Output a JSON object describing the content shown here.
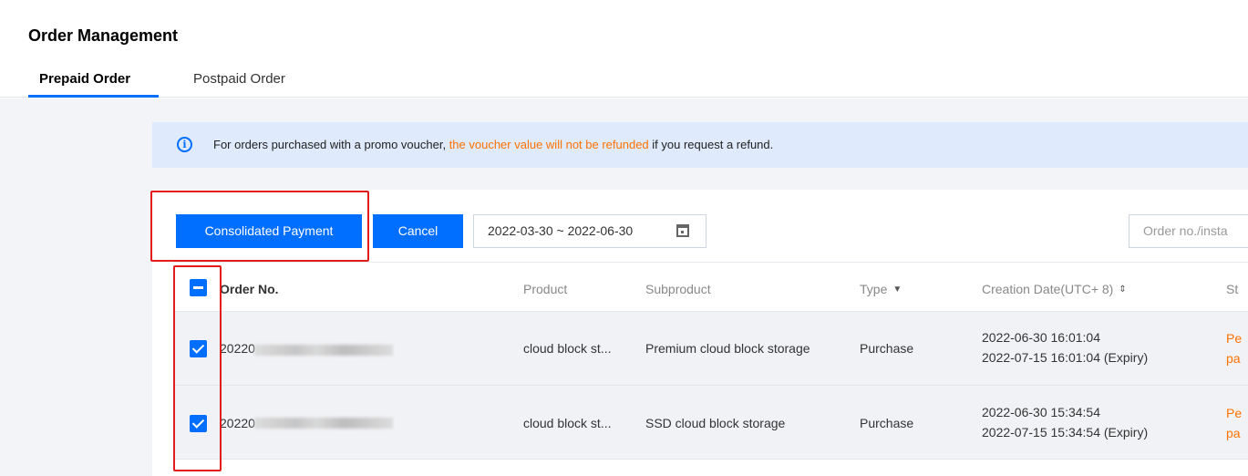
{
  "header": {
    "title": "Order Management",
    "tabs": [
      {
        "label": "Prepaid Order",
        "active": true
      },
      {
        "label": "Postpaid Order",
        "active": false
      }
    ]
  },
  "notice": {
    "icon": "info-icon",
    "text_before": "For orders purchased with a promo voucher, ",
    "text_highlight": "the voucher value will not be refunded",
    "text_after": " if you request a refund.",
    "highlight_color": "#ff7200"
  },
  "toolbar": {
    "consolidated_payment_label": "Consolidated Payment",
    "cancel_label": "Cancel",
    "date_range": "2022-03-30 ~ 2022-06-30",
    "search_placeholder": "Order no./insta"
  },
  "table": {
    "columns": {
      "order_no": "Order No.",
      "product": "Product",
      "subproduct": "Subproduct",
      "type": "Type",
      "creation_date": "Creation Date(UTC+ 8)",
      "status": "St"
    },
    "rows": [
      {
        "order_no": "20220",
        "product": "cloud block st...",
        "subproduct": "Premium cloud block storage",
        "type": "Purchase",
        "created": "2022-06-30 16:01:04",
        "expiry": "2022-07-15 16:01:04 (Expiry)",
        "status_line1": "Pe",
        "status_line2": "pa",
        "checked": true
      },
      {
        "order_no": "20220",
        "product": "cloud block st...",
        "subproduct": "SSD cloud block storage",
        "type": "Purchase",
        "created": "2022-06-30 15:34:54",
        "expiry": "2022-07-15 15:34:54 (Expiry)",
        "status_line1": "Pe",
        "status_line2": "pa",
        "checked": true
      }
    ]
  },
  "colors": {
    "primary": "#006eff",
    "warning": "#ff7200",
    "annotation_box": "#e11d1d"
  }
}
